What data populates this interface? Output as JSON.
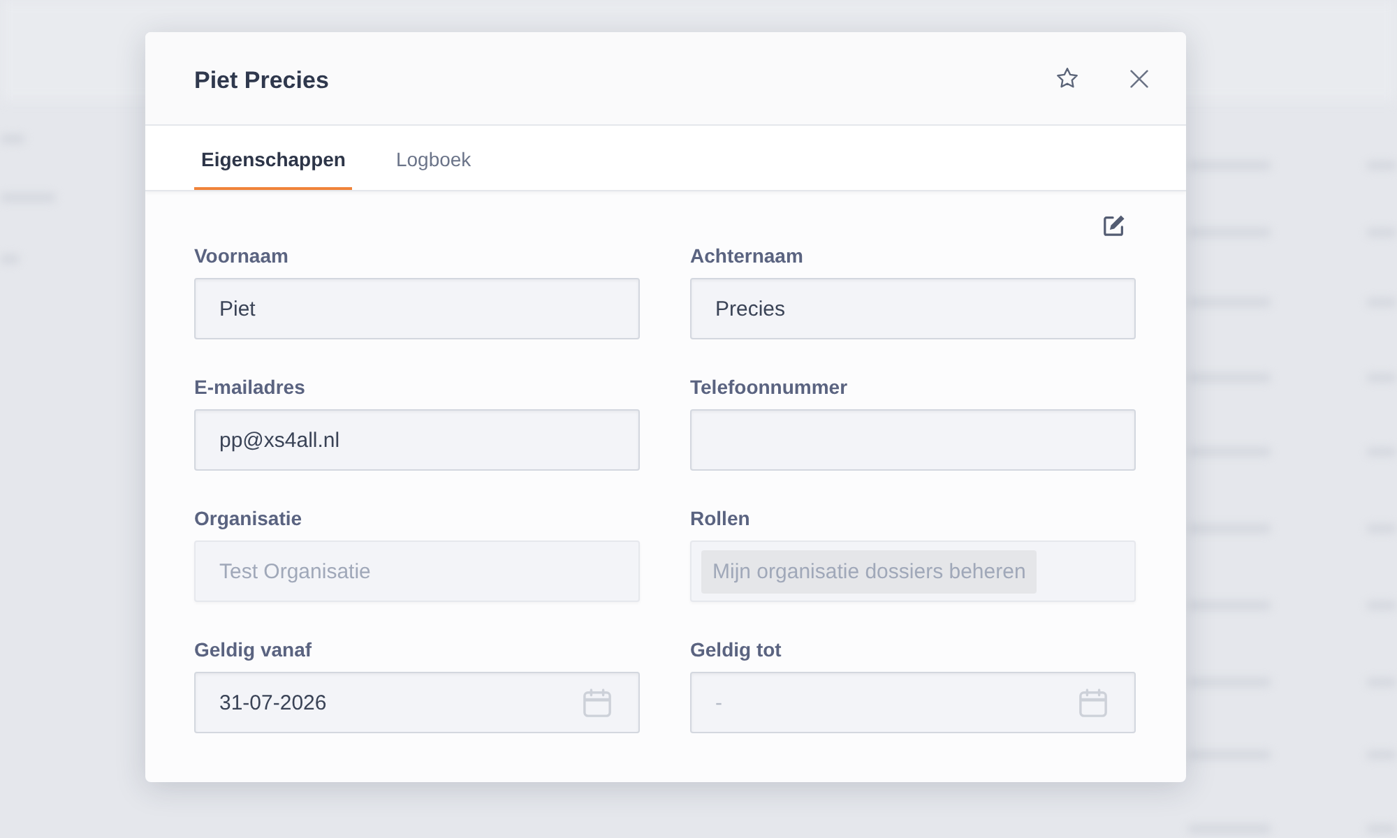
{
  "dialog": {
    "title": "Piet Precies"
  },
  "tabs": [
    {
      "label": "Eigenschappen",
      "selected": true
    },
    {
      "label": "Logboek",
      "selected": false
    }
  ],
  "fields": [
    {
      "label": "Voornaam",
      "kind": "text",
      "value": "Piet",
      "disabled": false
    },
    {
      "label": "Achternaam",
      "kind": "text",
      "value": "Precies",
      "disabled": false
    },
    {
      "label": "E-mailadres",
      "kind": "text",
      "value": "pp@xs4all.nl",
      "disabled": false
    },
    {
      "label": "Telefoonnummer",
      "kind": "text",
      "disabled": false
    },
    {
      "label": "Organisatie",
      "kind": "text",
      "value": "Test Organisatie",
      "disabled": true
    },
    {
      "label": "Rollen",
      "kind": "tags",
      "tags": [
        "Mijn organisatie dossiers beheren"
      ],
      "disabled": true
    },
    {
      "label": "Geldig vanaf",
      "kind": "date",
      "value": "31-07-2026",
      "disabled": false
    },
    {
      "label": "Geldig tot",
      "kind": "date",
      "placeholder": "-",
      "disabled": false
    }
  ]
}
